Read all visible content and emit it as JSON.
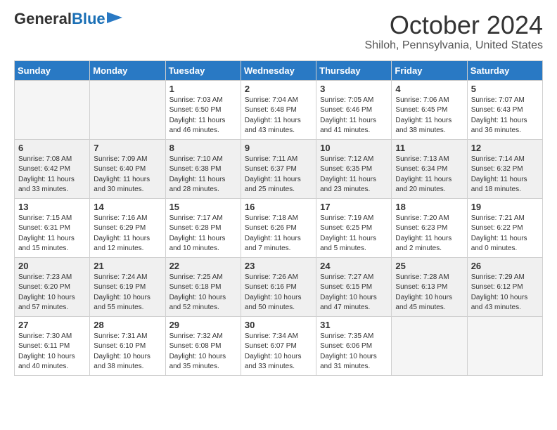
{
  "header": {
    "logo_general": "General",
    "logo_blue": "Blue",
    "title": "October 2024",
    "location": "Shiloh, Pennsylvania, United States"
  },
  "days_of_week": [
    "Sunday",
    "Monday",
    "Tuesday",
    "Wednesday",
    "Thursday",
    "Friday",
    "Saturday"
  ],
  "weeks": [
    [
      {
        "day": "",
        "info": ""
      },
      {
        "day": "",
        "info": ""
      },
      {
        "day": "1",
        "info": "Sunrise: 7:03 AM\nSunset: 6:50 PM\nDaylight: 11 hours and 46 minutes."
      },
      {
        "day": "2",
        "info": "Sunrise: 7:04 AM\nSunset: 6:48 PM\nDaylight: 11 hours and 43 minutes."
      },
      {
        "day": "3",
        "info": "Sunrise: 7:05 AM\nSunset: 6:46 PM\nDaylight: 11 hours and 41 minutes."
      },
      {
        "day": "4",
        "info": "Sunrise: 7:06 AM\nSunset: 6:45 PM\nDaylight: 11 hours and 38 minutes."
      },
      {
        "day": "5",
        "info": "Sunrise: 7:07 AM\nSunset: 6:43 PM\nDaylight: 11 hours and 36 minutes."
      }
    ],
    [
      {
        "day": "6",
        "info": "Sunrise: 7:08 AM\nSunset: 6:42 PM\nDaylight: 11 hours and 33 minutes."
      },
      {
        "day": "7",
        "info": "Sunrise: 7:09 AM\nSunset: 6:40 PM\nDaylight: 11 hours and 30 minutes."
      },
      {
        "day": "8",
        "info": "Sunrise: 7:10 AM\nSunset: 6:38 PM\nDaylight: 11 hours and 28 minutes."
      },
      {
        "day": "9",
        "info": "Sunrise: 7:11 AM\nSunset: 6:37 PM\nDaylight: 11 hours and 25 minutes."
      },
      {
        "day": "10",
        "info": "Sunrise: 7:12 AM\nSunset: 6:35 PM\nDaylight: 11 hours and 23 minutes."
      },
      {
        "day": "11",
        "info": "Sunrise: 7:13 AM\nSunset: 6:34 PM\nDaylight: 11 hours and 20 minutes."
      },
      {
        "day": "12",
        "info": "Sunrise: 7:14 AM\nSunset: 6:32 PM\nDaylight: 11 hours and 18 minutes."
      }
    ],
    [
      {
        "day": "13",
        "info": "Sunrise: 7:15 AM\nSunset: 6:31 PM\nDaylight: 11 hours and 15 minutes."
      },
      {
        "day": "14",
        "info": "Sunrise: 7:16 AM\nSunset: 6:29 PM\nDaylight: 11 hours and 12 minutes."
      },
      {
        "day": "15",
        "info": "Sunrise: 7:17 AM\nSunset: 6:28 PM\nDaylight: 11 hours and 10 minutes."
      },
      {
        "day": "16",
        "info": "Sunrise: 7:18 AM\nSunset: 6:26 PM\nDaylight: 11 hours and 7 minutes."
      },
      {
        "day": "17",
        "info": "Sunrise: 7:19 AM\nSunset: 6:25 PM\nDaylight: 11 hours and 5 minutes."
      },
      {
        "day": "18",
        "info": "Sunrise: 7:20 AM\nSunset: 6:23 PM\nDaylight: 11 hours and 2 minutes."
      },
      {
        "day": "19",
        "info": "Sunrise: 7:21 AM\nSunset: 6:22 PM\nDaylight: 11 hours and 0 minutes."
      }
    ],
    [
      {
        "day": "20",
        "info": "Sunrise: 7:23 AM\nSunset: 6:20 PM\nDaylight: 10 hours and 57 minutes."
      },
      {
        "day": "21",
        "info": "Sunrise: 7:24 AM\nSunset: 6:19 PM\nDaylight: 10 hours and 55 minutes."
      },
      {
        "day": "22",
        "info": "Sunrise: 7:25 AM\nSunset: 6:18 PM\nDaylight: 10 hours and 52 minutes."
      },
      {
        "day": "23",
        "info": "Sunrise: 7:26 AM\nSunset: 6:16 PM\nDaylight: 10 hours and 50 minutes."
      },
      {
        "day": "24",
        "info": "Sunrise: 7:27 AM\nSunset: 6:15 PM\nDaylight: 10 hours and 47 minutes."
      },
      {
        "day": "25",
        "info": "Sunrise: 7:28 AM\nSunset: 6:13 PM\nDaylight: 10 hours and 45 minutes."
      },
      {
        "day": "26",
        "info": "Sunrise: 7:29 AM\nSunset: 6:12 PM\nDaylight: 10 hours and 43 minutes."
      }
    ],
    [
      {
        "day": "27",
        "info": "Sunrise: 7:30 AM\nSunset: 6:11 PM\nDaylight: 10 hours and 40 minutes."
      },
      {
        "day": "28",
        "info": "Sunrise: 7:31 AM\nSunset: 6:10 PM\nDaylight: 10 hours and 38 minutes."
      },
      {
        "day": "29",
        "info": "Sunrise: 7:32 AM\nSunset: 6:08 PM\nDaylight: 10 hours and 35 minutes."
      },
      {
        "day": "30",
        "info": "Sunrise: 7:34 AM\nSunset: 6:07 PM\nDaylight: 10 hours and 33 minutes."
      },
      {
        "day": "31",
        "info": "Sunrise: 7:35 AM\nSunset: 6:06 PM\nDaylight: 10 hours and 31 minutes."
      },
      {
        "day": "",
        "info": ""
      },
      {
        "day": "",
        "info": ""
      }
    ]
  ]
}
